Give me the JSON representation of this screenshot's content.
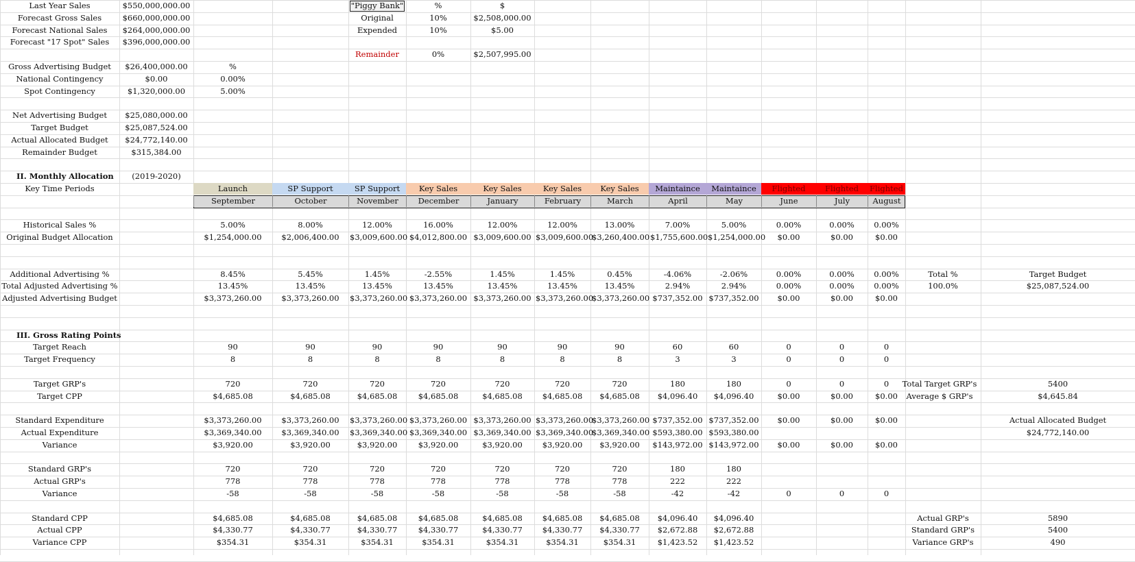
{
  "colors": {
    "launch": "#ddd9c4",
    "sp_support": "#c5d9f1",
    "key_sales": "#f8cbad",
    "maintaince": "#b4a7d6",
    "flighted": "#ff0000",
    "month_bg": "#d9d9d9",
    "remainder_text": "#c00000",
    "gridline": "#dcdcdc"
  },
  "summary": {
    "rows": [
      {
        "label": "Last Year Sales",
        "value": "$550,000,000.00"
      },
      {
        "label": "Forecast Gross Sales",
        "value": "$660,000,000.00"
      },
      {
        "label": "Forecast National Sales",
        "value": "$264,000,000.00"
      },
      {
        "label": "Forecast \"17 Spot\" Sales",
        "value": "$396,000,000.00"
      }
    ]
  },
  "piggy_bank": {
    "title": "\"Piggy Bank\"",
    "pct_header": "%",
    "dollar_header": "$",
    "original_label": "Original",
    "original_pct": "10%",
    "original_amount": "$2,508,000.00",
    "expended_label": "Expended",
    "expended_pct": "10%",
    "expended_amount": "$5.00",
    "remainder_label": "Remainder",
    "remainder_pct": "0%",
    "remainder_amount": "$2,507,995.00"
  },
  "budget": {
    "pct_header": "%",
    "gross_label": "Gross Advertising Budget",
    "gross_value": "$26,400,000.00",
    "national_label": "National Contingency",
    "national_value": "$0.00",
    "national_pct": "0.00%",
    "spot_label": "Spot Contingency",
    "spot_value": "$1,320,000.00",
    "spot_pct": "5.00%",
    "net_label": "Net Advertising Budget",
    "net_value": "$25,080,000.00",
    "target_label": "Target Budget",
    "target_value": "$25,087,524.00",
    "actual_label": "Actual Allocated Budget",
    "actual_value": "$24,772,140.00",
    "remainder_label": "Remainder Budget",
    "remainder_value": "$315,384.00"
  },
  "section2": {
    "title": "II. Monthly Allocation",
    "year": "(2019-2020)",
    "periods_label": "Key Time Periods",
    "periods": [
      "Launch",
      "SP Support",
      "SP Support",
      "Key Sales",
      "Key Sales",
      "Key Sales",
      "Key Sales",
      "Maintaince",
      "Maintaince",
      "Flighted",
      "Flighted",
      "Flighted"
    ],
    "months": [
      "September",
      "October",
      "November",
      "December",
      "January",
      "February",
      "March",
      "April",
      "May",
      "June",
      "July",
      "August"
    ]
  },
  "rows": {
    "historical": {
      "label": "Historical Sales %",
      "values": [
        "5.00%",
        "8.00%",
        "12.00%",
        "16.00%",
        "12.00%",
        "12.00%",
        "13.00%",
        "7.00%",
        "5.00%",
        "0.00%",
        "0.00%",
        "0.00%"
      ]
    },
    "original": {
      "label": "Original Budget Allocation",
      "values": [
        "$1,254,000.00",
        "$2,006,400.00",
        "$3,009,600.00",
        "$4,012,800.00",
        "$3,009,600.00",
        "$3,009,600.00",
        "$3,260,400.00",
        "$1,755,600.00",
        "$1,254,000.00",
        "$0.00",
        "$0.00",
        "$0.00"
      ]
    },
    "additional": {
      "label": "Additional Advertising %",
      "values": [
        "8.45%",
        "5.45%",
        "1.45%",
        "-2.55%",
        "1.45%",
        "1.45%",
        "0.45%",
        "-4.06%",
        "-2.06%",
        "0.00%",
        "0.00%",
        "0.00%"
      ]
    },
    "total_adj": {
      "label": "Total Adjusted Advertising %",
      "values": [
        "13.45%",
        "13.45%",
        "13.45%",
        "13.45%",
        "13.45%",
        "13.45%",
        "13.45%",
        "2.94%",
        "2.94%",
        "0.00%",
        "0.00%",
        "0.00%"
      ]
    },
    "adj_budget": {
      "label": "Adjusted Advertising Budget",
      "values": [
        "$3,373,260.00",
        "$3,373,260.00",
        "$3,373,260.00",
        "$3,373,260.00",
        "$3,373,260.00",
        "$3,373,260.00",
        "$3,373,260.00",
        "$737,352.00",
        "$737,352.00",
        "$0.00",
        "$0.00",
        "$0.00"
      ]
    },
    "section3_title": "III. Gross Rating Points",
    "reach": {
      "label": "Target Reach",
      "values": [
        "90",
        "90",
        "90",
        "90",
        "90",
        "90",
        "90",
        "60",
        "60",
        "0",
        "0",
        "0"
      ]
    },
    "frequency": {
      "label": "Target Frequency",
      "values": [
        "8",
        "8",
        "8",
        "8",
        "8",
        "8",
        "8",
        "3",
        "3",
        "0",
        "0",
        "0"
      ]
    },
    "target_grps": {
      "label": "Target GRP's",
      "values": [
        "720",
        "720",
        "720",
        "720",
        "720",
        "720",
        "720",
        "180",
        "180",
        "0",
        "0",
        "0"
      ]
    },
    "target_cpp": {
      "label": "Target CPP",
      "values": [
        "$4,685.08",
        "$4,685.08",
        "$4,685.08",
        "$4,685.08",
        "$4,685.08",
        "$4,685.08",
        "$4,685.08",
        "$4,096.40",
        "$4,096.40",
        "$0.00",
        "$0.00",
        "$0.00"
      ]
    },
    "std_exp": {
      "label": "Standard Expenditure",
      "values": [
        "$3,373,260.00",
        "$3,373,260.00",
        "$3,373,260.00",
        "$3,373,260.00",
        "$3,373,260.00",
        "$3,373,260.00",
        "$3,373,260.00",
        "$737,352.00",
        "$737,352.00",
        "$0.00",
        "$0.00",
        "$0.00"
      ]
    },
    "act_exp": {
      "label": "Actual Expenditure",
      "values": [
        "$3,369,340.00",
        "$3,369,340.00",
        "$3,369,340.00",
        "$3,369,340.00",
        "$3,369,340.00",
        "$3,369,340.00",
        "$3,369,340.00",
        "$593,380.00",
        "$593,380.00",
        "",
        "",
        ""
      ]
    },
    "variance": {
      "label": "Variance",
      "values": [
        "$3,920.00",
        "$3,920.00",
        "$3,920.00",
        "$3,920.00",
        "$3,920.00",
        "$3,920.00",
        "$3,920.00",
        "$143,972.00",
        "$143,972.00",
        "$0.00",
        "$0.00",
        "$0.00"
      ]
    },
    "std_grps": {
      "label": "Standard GRP's",
      "values": [
        "720",
        "720",
        "720",
        "720",
        "720",
        "720",
        "720",
        "180",
        "180",
        "",
        "",
        ""
      ]
    },
    "act_grps": {
      "label": "Actual GRP's",
      "values": [
        "778",
        "778",
        "778",
        "778",
        "778",
        "778",
        "778",
        "222",
        "222",
        "",
        "",
        ""
      ]
    },
    "grp_var": {
      "label": "Variance",
      "values": [
        "-58",
        "-58",
        "-58",
        "-58",
        "-58",
        "-58",
        "-58",
        "-42",
        "-42",
        "0",
        "0",
        "0"
      ]
    },
    "std_cpp": {
      "label": "Standard CPP",
      "values": [
        "$4,685.08",
        "$4,685.08",
        "$4,685.08",
        "$4,685.08",
        "$4,685.08",
        "$4,685.08",
        "$4,685.08",
        "$4,096.40",
        "$4,096.40",
        "",
        "",
        ""
      ]
    },
    "act_cpp": {
      "label": "Actual CPP",
      "values": [
        "$4,330.77",
        "$4,330.77",
        "$4,330.77",
        "$4,330.77",
        "$4,330.77",
        "$4,330.77",
        "$4,330.77",
        "$2,672.88",
        "$2,672.88",
        "",
        "",
        ""
      ]
    },
    "var_cpp": {
      "label": "Variance CPP",
      "values": [
        "$354.31",
        "$354.31",
        "$354.31",
        "$354.31",
        "$354.31",
        "$354.31",
        "$354.31",
        "$1,423.52",
        "$1,423.52",
        "",
        "",
        ""
      ]
    }
  },
  "right_panel": {
    "total_pct_label": "Total %",
    "total_pct_value": "100.0%",
    "target_budget_label": "Target Budget",
    "target_budget_value": "$25,087,524.00",
    "total_grps_label": "Total Target GRP's",
    "total_grps_value": "5400",
    "avg_grp_label": "Average $ GRP's",
    "avg_grp_value": "$4,645.84",
    "actual_alloc_label": "Actual Allocated Budget",
    "actual_alloc_value": "$24,772,140.00",
    "actual_grps_label": "Actual GRP's",
    "actual_grps_value": "5890",
    "standard_grps_label": "Standard GRP's",
    "standard_grps_value": "5400",
    "variance_grps_label": "Variance GRP's",
    "variance_grps_value": "490"
  }
}
